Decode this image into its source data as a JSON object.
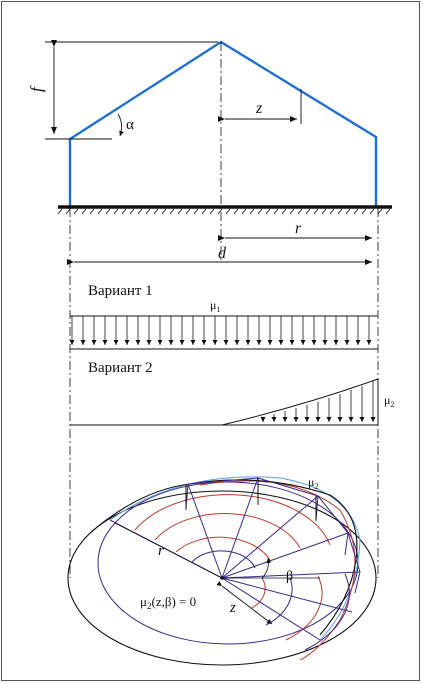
{
  "labels": {
    "f": "f",
    "alpha": "α",
    "z": "z",
    "r": "r",
    "d": "d",
    "variant1": "Вариант 1",
    "variant2": "Вариант 2",
    "mu1": "μ",
    "mu1_sub": "1",
    "mu2_right": "μ",
    "mu2_right_sub": "2",
    "mu2_bottom": "μ",
    "mu2_bottom_sub": "2",
    "r_bottom": "r",
    "beta": "β",
    "z_bottom": "z",
    "formula_mu": "μ",
    "formula_sub": "2",
    "formula_rest": "(z,β) = 0"
  },
  "colors": {
    "roof": "#1f6fd0",
    "ink": "#111111",
    "rings_red": "#c0392b",
    "rings_blue": "#5aa0e0",
    "rings_purple": "#3b2a8a"
  }
}
